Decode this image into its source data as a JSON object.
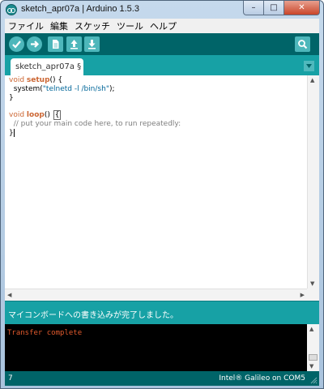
{
  "window": {
    "title": "sketch_apr07a | Arduino 1.5.3",
    "controls": {
      "minimize": "–",
      "maximize": "□",
      "close": "✕"
    }
  },
  "menu": [
    "ファイル",
    "編集",
    "スケッチ",
    "ツール",
    "ヘルプ"
  ],
  "toolbar": {
    "buttons": [
      "verify-icon",
      "upload-icon",
      "new-icon",
      "open-icon",
      "save-icon"
    ],
    "right_button": "serial-monitor-icon",
    "accent": "#17a1a5",
    "dark": "#006468"
  },
  "tabs": [
    {
      "label": "sketch_apr07a §"
    }
  ],
  "editor": {
    "lines": {
      "l1_type": "void",
      "l1_fn": "setup",
      "l1_rest": "() {",
      "l2_pre": "  system(",
      "l2_str": "\"telnetd -l /bin/sh\"",
      "l2_post": ");",
      "l3": "}",
      "l4": "",
      "l5_type": "void",
      "l5_fn": "loop",
      "l5_rest": "() ",
      "l5_brace": "{",
      "l6": "  // put your main code here, to run repeatedly:",
      "l7": "}"
    }
  },
  "status": {
    "message": "マイコンボードへの書き込みが完了しました。"
  },
  "console": {
    "output": "Transfer complete"
  },
  "footer": {
    "line_number": "7",
    "board": "Intel® Galileo on COM5"
  }
}
